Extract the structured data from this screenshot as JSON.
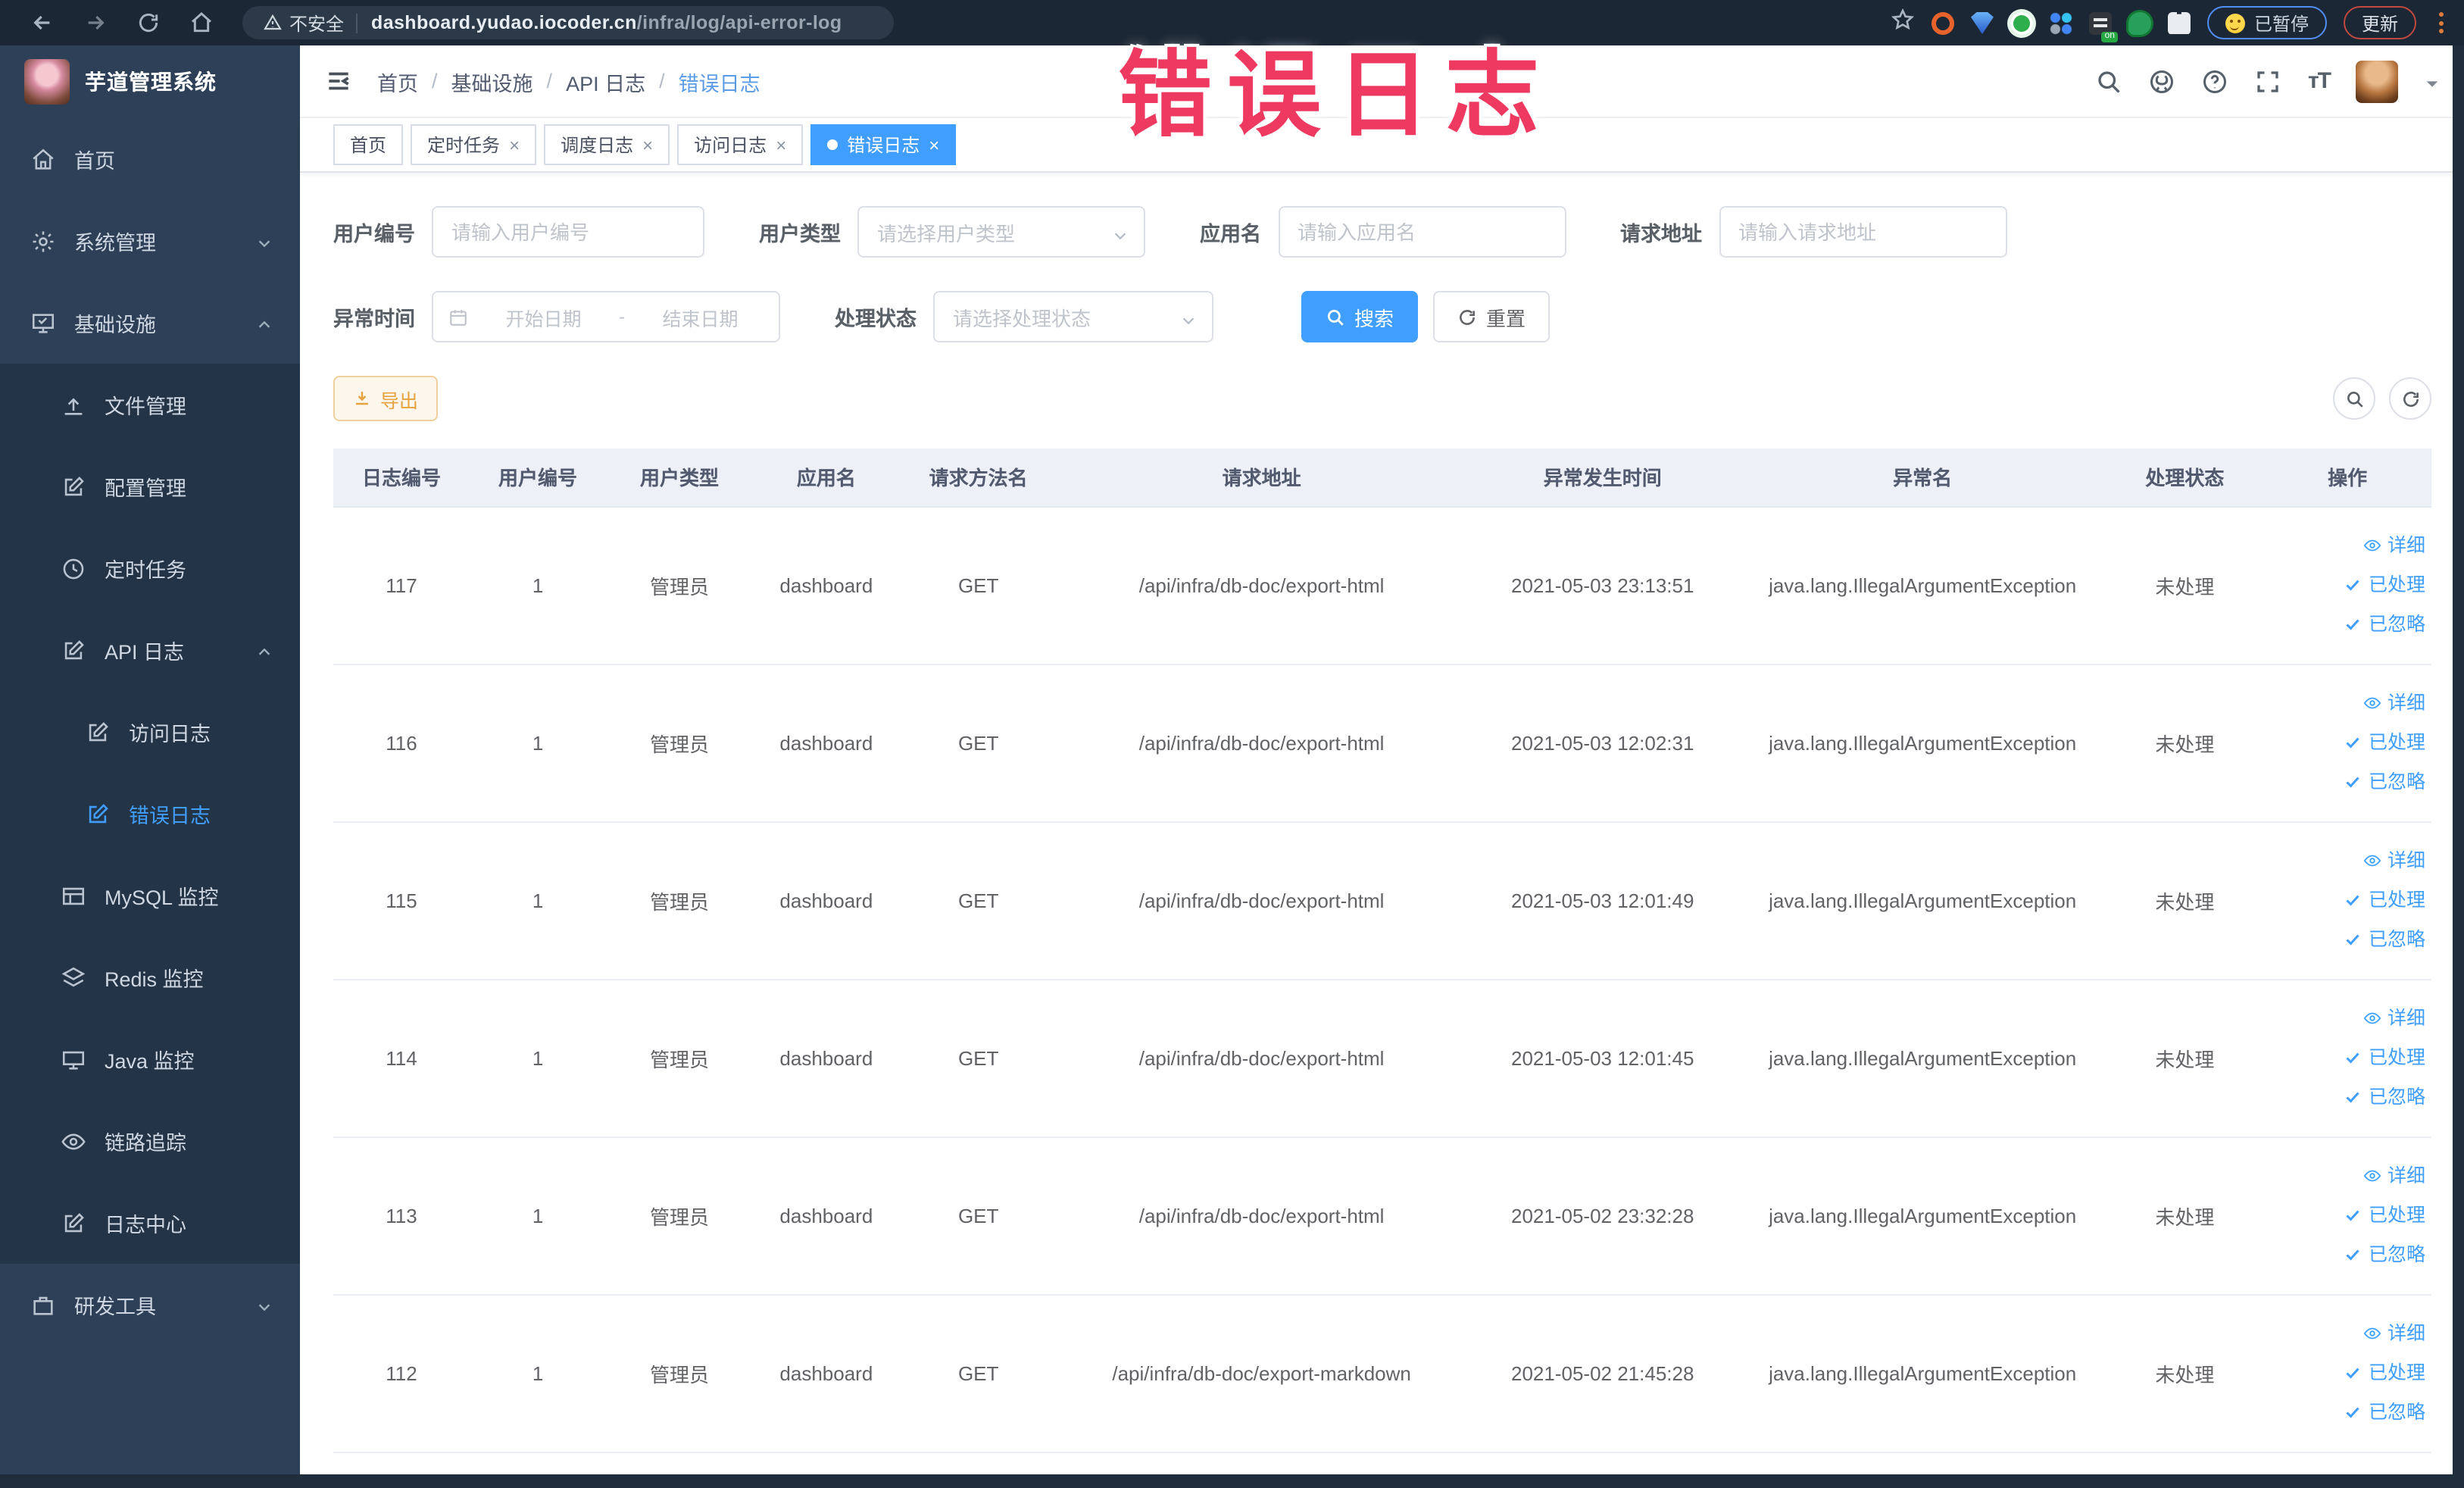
{
  "browser": {
    "security_label": "不安全",
    "url_host": "dashboard.yudao.iocoder.cn",
    "url_path": "/infra/log/api-error-log",
    "paused_pill": "已暂停",
    "update_button": "更新"
  },
  "watermark": "错误日志",
  "sidebar": {
    "app_title": "芋道管理系统",
    "items": [
      {
        "label": "首页",
        "icon": "home",
        "level": 1,
        "dark": false,
        "arrow": null,
        "active": false
      },
      {
        "label": "系统管理",
        "icon": "gear",
        "level": 1,
        "dark": false,
        "arrow": "down",
        "active": false
      },
      {
        "label": "基础设施",
        "icon": "monitor",
        "level": 1,
        "dark": false,
        "arrow": "up",
        "active": false
      },
      {
        "label": "文件管理",
        "icon": "upload",
        "level": 2,
        "dark": true,
        "arrow": null,
        "active": false
      },
      {
        "label": "配置管理",
        "icon": "edit",
        "level": 2,
        "dark": true,
        "arrow": null,
        "active": false
      },
      {
        "label": "定时任务",
        "icon": "clock",
        "level": 2,
        "dark": true,
        "arrow": null,
        "active": false
      },
      {
        "label": "API 日志",
        "icon": "edit",
        "level": 2,
        "dark": true,
        "arrow": "up",
        "active": false
      },
      {
        "label": "访问日志",
        "icon": "edit",
        "level": 3,
        "dark": true,
        "arrow": null,
        "active": false
      },
      {
        "label": "错误日志",
        "icon": "edit",
        "level": 3,
        "dark": true,
        "arrow": null,
        "active": true
      },
      {
        "label": "MySQL 监控",
        "icon": "db",
        "level": 2,
        "dark": true,
        "arrow": null,
        "active": false
      },
      {
        "label": "Redis 监控",
        "icon": "layers",
        "level": 2,
        "dark": true,
        "arrow": null,
        "active": false
      },
      {
        "label": "Java 监控",
        "icon": "screen",
        "level": 2,
        "dark": true,
        "arrow": null,
        "active": false
      },
      {
        "label": "链路追踪",
        "icon": "eye",
        "level": 2,
        "dark": true,
        "arrow": null,
        "active": false
      },
      {
        "label": "日志中心",
        "icon": "edit",
        "level": 2,
        "dark": true,
        "arrow": null,
        "active": false
      },
      {
        "label": "研发工具",
        "icon": "box",
        "level": 1,
        "dark": false,
        "arrow": "down",
        "active": false
      }
    ]
  },
  "breadcrumb": [
    "首页",
    "基础设施",
    "API 日志",
    "错误日志"
  ],
  "tabs": [
    {
      "label": "首页",
      "closable": false,
      "active": false
    },
    {
      "label": "定时任务",
      "closable": true,
      "active": false
    },
    {
      "label": "调度日志",
      "closable": true,
      "active": false
    },
    {
      "label": "访问日志",
      "closable": true,
      "active": false
    },
    {
      "label": "错误日志",
      "closable": true,
      "active": true
    }
  ],
  "filters": {
    "user_id": {
      "label": "用户编号",
      "placeholder": "请输入用户编号"
    },
    "user_type": {
      "label": "用户类型",
      "placeholder": "请选择用户类型"
    },
    "app_name": {
      "label": "应用名",
      "placeholder": "请输入应用名"
    },
    "req_url": {
      "label": "请求地址",
      "placeholder": "请输入请求地址"
    },
    "time": {
      "label": "异常时间",
      "start": "开始日期",
      "separator": "-",
      "end": "结束日期"
    },
    "status": {
      "label": "处理状态",
      "placeholder": "请选择处理状态"
    },
    "search_label": "搜索",
    "reset_label": "重置"
  },
  "toolbar": {
    "export_label": "导出"
  },
  "table": {
    "headers": [
      {
        "key": "id",
        "label": "日志编号",
        "width": "6.5%"
      },
      {
        "key": "user_id",
        "label": "用户编号",
        "width": "6.5%"
      },
      {
        "key": "user_type",
        "label": "用户类型",
        "width": "7%"
      },
      {
        "key": "app_name",
        "label": "应用名",
        "width": "7%"
      },
      {
        "key": "method",
        "label": "请求方法名",
        "width": "7.5%"
      },
      {
        "key": "url",
        "label": "请求地址",
        "width": "19.5%"
      },
      {
        "key": "time",
        "label": "异常发生时间",
        "width": "13%"
      },
      {
        "key": "exception",
        "label": "异常名",
        "width": "17.5%"
      },
      {
        "key": "status",
        "label": "处理状态",
        "width": "7.5%"
      },
      {
        "key": "actions",
        "label": "操作",
        "width": "8%"
      }
    ],
    "rows": [
      {
        "id": "117",
        "user_id": "1",
        "user_type": "管理员",
        "app_name": "dashboard",
        "method": "GET",
        "url": "/api/infra/db-doc/export-html",
        "time": "2021-05-03 23:13:51",
        "exception": "java.lang.IllegalArgumentException",
        "status": "未处理"
      },
      {
        "id": "116",
        "user_id": "1",
        "user_type": "管理员",
        "app_name": "dashboard",
        "method": "GET",
        "url": "/api/infra/db-doc/export-html",
        "time": "2021-05-03 12:02:31",
        "exception": "java.lang.IllegalArgumentException",
        "status": "未处理"
      },
      {
        "id": "115",
        "user_id": "1",
        "user_type": "管理员",
        "app_name": "dashboard",
        "method": "GET",
        "url": "/api/infra/db-doc/export-html",
        "time": "2021-05-03 12:01:49",
        "exception": "java.lang.IllegalArgumentException",
        "status": "未处理"
      },
      {
        "id": "114",
        "user_id": "1",
        "user_type": "管理员",
        "app_name": "dashboard",
        "method": "GET",
        "url": "/api/infra/db-doc/export-html",
        "time": "2021-05-03 12:01:45",
        "exception": "java.lang.IllegalArgumentException",
        "status": "未处理"
      },
      {
        "id": "113",
        "user_id": "1",
        "user_type": "管理员",
        "app_name": "dashboard",
        "method": "GET",
        "url": "/api/infra/db-doc/export-html",
        "time": "2021-05-02 23:32:28",
        "exception": "java.lang.IllegalArgumentException",
        "status": "未处理"
      },
      {
        "id": "112",
        "user_id": "1",
        "user_type": "管理员",
        "app_name": "dashboard",
        "method": "GET",
        "url": "/api/infra/db-doc/export-markdown",
        "time": "2021-05-02 21:45:28",
        "exception": "java.lang.IllegalArgumentException",
        "status": "未处理"
      }
    ],
    "row_actions": [
      {
        "label": "详细",
        "icon": "eye"
      },
      {
        "label": "已处理",
        "icon": "check"
      },
      {
        "label": "已忽略",
        "icon": "check"
      }
    ]
  },
  "colors": {
    "accent": "#409eff",
    "warning": "#e6a23c",
    "watermark": "#ee3a60",
    "chrome_bg": "#1c2735",
    "sidebar_bg": "#2d4057",
    "submenu_bg": "#233447"
  }
}
